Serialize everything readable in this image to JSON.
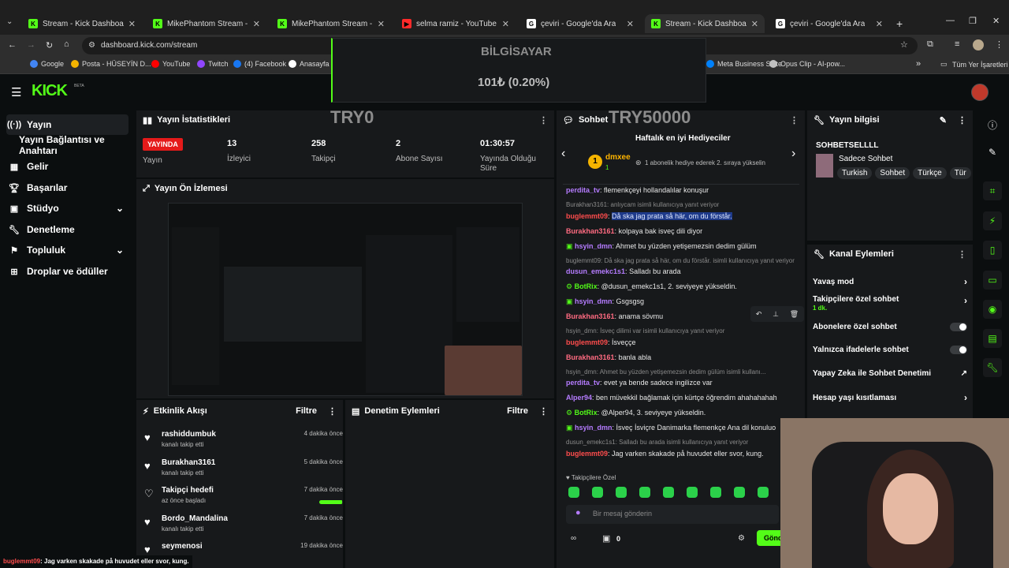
{
  "browser": {
    "tabs": [
      {
        "label": "Stream - Kick Dashboard",
        "fav_color": "#53fc18",
        "fav": "K"
      },
      {
        "label": "MikePhantom Stream - Watch L",
        "fav_color": "#53fc18",
        "fav": "K"
      },
      {
        "label": "MikePhantom Stream - Watch L",
        "fav_color": "#53fc18",
        "fav": "K"
      },
      {
        "label": "selma ramiz - YouTube",
        "fav_color": "#ff2a2a",
        "fav": "▶"
      },
      {
        "label": "çeviri - Google'da Ara",
        "fav_color": "#ffffff",
        "fav": "G"
      },
      {
        "label": "Stream - Kick Dashboard",
        "fav_color": "#53fc18",
        "fav": "K"
      },
      {
        "label": "çeviri - Google'da Ara",
        "fav_color": "#ffffff",
        "fav": "G"
      }
    ],
    "url": "dashboard.kick.com/stream",
    "bookmarks": [
      "Google",
      "Posta - HÜSEYİN D...",
      "YouTube",
      "Twitch",
      "(4) Facebook",
      "Anasayfa /",
      "Meta Business Suite",
      "Opus Clip - AI-pow..."
    ],
    "all_bookmarks": "Tüm Yer İşaretleri"
  },
  "overlay": {
    "title": "BİLGİSAYAR",
    "value": "101₺ (0.20%)",
    "try0": "TRY0",
    "try50000": "TRY50000"
  },
  "brand": {
    "logo": "KICK",
    "beta": "BETA"
  },
  "nav": {
    "items": [
      "Yayın",
      "Yayın Bağlantısı ve Anahtarı",
      "Gelir",
      "Başarılar",
      "Stüdyo",
      "Denetleme",
      "Topluluk",
      "Droplar ve ödüller"
    ]
  },
  "stats": {
    "title": "Yayın İstatistikleri",
    "live": "YAYINDA",
    "live_label": "Yayın",
    "viewers": "13",
    "viewers_label": "İzleyici",
    "followers": "258",
    "followers_label": "Takipçi",
    "subs": "2",
    "subs_label": "Abone Sayısı",
    "uptime": "01:30:57",
    "uptime_label": "Yayında Olduğu Süre"
  },
  "preview": {
    "title": "Yayın Ön İzlemesi"
  },
  "activity": {
    "title": "Etkinlik Akışı",
    "filter": "Filtre",
    "items": [
      {
        "name": "rashiddumbuk",
        "sub": "kanalı takip etti",
        "time": "4 dakika önce"
      },
      {
        "name": "Burakhan3161",
        "sub": "kanalı takip etti",
        "time": "5 dakika önce"
      },
      {
        "name": "Takipçi hedefi",
        "sub": "az önce başladı",
        "time": "7 dakika önce"
      },
      {
        "name": "Bordo_Mandalina",
        "sub": "kanalı takip etti",
        "time": "7 dakika önce"
      },
      {
        "name": "seymenosi",
        "sub": "",
        "time": "19 dakika önce"
      }
    ],
    "goal_progress": 0.95
  },
  "moderation": {
    "title": "Denetim Eylemleri",
    "filter": "Filtre"
  },
  "chat": {
    "title": "Sohbet",
    "weekly_title": "Haftalık en iyi Hediyeciler",
    "top_gifter": "dmxee",
    "top_rank": "1",
    "top_count": "1",
    "gift_hint": "1 abonelik hediye ederek 2. sıraya yükselin",
    "messages": [
      {
        "user": "perdita_tv",
        "color": "#b57cff",
        "text": "flemenkçeyi hollandalılar konuşur",
        "reply": ""
      },
      {
        "user": "",
        "color": "",
        "text": "",
        "reply": "Burakhan3161: anlıycam isimli kullanıcıya yanıt veriyor"
      },
      {
        "user": "buglemmt09",
        "color": "#ff4d4d",
        "text": "Då ska jag prata så här, om du förstår.",
        "reply": "",
        "hl": true
      },
      {
        "user": "Burakhan3161",
        "color": "#ff6b81",
        "text": "kolpaya bak isveç dili diyor",
        "reply": ""
      },
      {
        "user": "hsyin_dmn",
        "color": "#b57cff",
        "text": "Ahmet bu yüzden yetişemezsin dedim gülüm",
        "reply": ""
      },
      {
        "user": "",
        "color": "",
        "text": "",
        "reply": "buglemmt09: Då ska jag prata så här, om du förstår. isimli kullanıcıya yanıt veriyor"
      },
      {
        "user": "dusun_emekc1s1",
        "color": "#b57cff",
        "text": "Salladı bu arada",
        "reply": ""
      },
      {
        "user": "BotRix",
        "color": "#53fc18",
        "text": "@dusun_emekc1s1, 2. seviyeye yükseldin.",
        "reply": ""
      },
      {
        "user": "hsyin_dmn",
        "color": "#b57cff",
        "text": "Gsgsgsg",
        "reply": ""
      },
      {
        "user": "Burakhan3161",
        "color": "#ff6b81",
        "text": "anama sövmu",
        "reply": ""
      },
      {
        "user": "",
        "color": "",
        "text": "",
        "reply": "hsyin_dmn: İsveç dilimi var isimli kullanıcıya yanıt veriyor"
      },
      {
        "user": "buglemmt09",
        "color": "#ff4d4d",
        "text": "İsveççe",
        "reply": ""
      },
      {
        "user": "Burakhan3161",
        "color": "#ff6b81",
        "text": "banla abla",
        "reply": ""
      },
      {
        "user": "",
        "color": "",
        "text": "",
        "reply": "hsyin_dmn: Ahmet bu yüzden yetişemezsin dedim gülüm isimli kullanı..."
      },
      {
        "user": "perdita_tv",
        "color": "#b57cff",
        "text": "evet ya bende sadece ingilizce var",
        "reply": ""
      },
      {
        "user": "Alper94",
        "color": "#b57cff",
        "text": "ben müvekkil bağlamak için kürtçe öğrendim ahahahahah",
        "reply": ""
      },
      {
        "user": "BotRix",
        "color": "#53fc18",
        "text": "@Alper94, 3. seviyeye yükseldin.",
        "reply": ""
      },
      {
        "user": "hsyin_dmn",
        "color": "#b57cff",
        "text": "İsveç İsviçre Danimarka flemenkçe Ana dil konuluo",
        "reply": ""
      },
      {
        "user": "",
        "color": "",
        "text": "",
        "reply": "dusun_emekc1s1: Salladı bu arada isimli kullanıcıya yanıt veriyor"
      },
      {
        "user": "buglemmt09",
        "color": "#ff4d4d",
        "text": "Jag varken skakade på huvudet eller svor, kung.",
        "reply": ""
      }
    ],
    "followers_only": "Takipçilere Özel",
    "input_placeholder": "Bir mesaj gönderin",
    "count": "0",
    "send": "Gönder"
  },
  "info": {
    "title": "Yayın bilgisi",
    "channel": "SOHBETSELLLL",
    "category": "Sadece Sohbet",
    "tags": [
      "Turkish",
      "Sohbet",
      "Türkçe",
      "Tür"
    ]
  },
  "channel_actions": {
    "title": "Kanal Eylemleri",
    "slow": "Yavaş mod",
    "followers_chat": "Takipçilere özel sohbet",
    "followers_sub": "1 dk.",
    "subs_chat": "Abonelere özel sohbet",
    "emote_chat": "Yalnızca ifadelerle sohbet",
    "ai_mod": "Yapay Zeka ile Sohbet Denetimi",
    "age": "Hesap yaşı kısıtlaması"
  },
  "bottom_caption": {
    "user": "buglemmt09",
    "text": ": Jag varken skakade på huvudet eller svor, kung."
  }
}
